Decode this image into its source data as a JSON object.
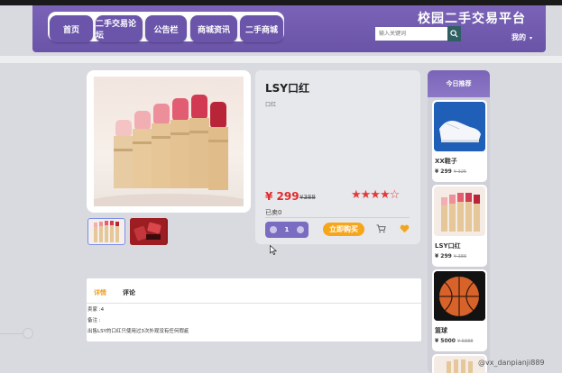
{
  "header": {
    "nav": [
      "首页",
      "二手交易论坛",
      "公告栏",
      "商城资讯",
      "二手商城"
    ],
    "site_title": "校园二手交易平台",
    "search_placeholder": "输入关键词",
    "user_menu": "我的"
  },
  "product": {
    "title": "LSY口红",
    "subtitle": "口红",
    "price": "¥ 299",
    "original_price": "¥388",
    "rating_stars": 4.5,
    "stars_text": "★★★★☆",
    "sold": "已卖0",
    "quantity": "1",
    "buy_label": "立即购买"
  },
  "detail": {
    "tabs": [
      "详情",
      "评论"
    ],
    "lines": [
      "卖家 :4",
      "备注 :",
      "出售LSY的口红只使用过3次外观没有任何瑕疵"
    ]
  },
  "recommend": {
    "title": "今日推荐",
    "items": [
      {
        "name": "XX鞋子",
        "price": "¥ 299",
        "original": "¥ 325"
      },
      {
        "name": "LSY口红",
        "price": "¥ 299",
        "original": "¥ 388"
      },
      {
        "name": "篮球",
        "price": "¥ 5000",
        "original": "¥ 5888"
      }
    ]
  },
  "watermark": "@vx_danpianji889",
  "colors": {
    "header": "#6b55ab",
    "price": "#e12b2b",
    "buy_button": "#f6a61a",
    "active_tab": "#f0a020"
  }
}
